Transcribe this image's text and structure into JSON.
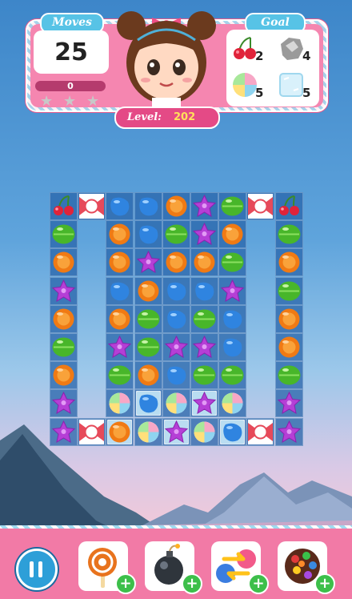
{
  "header": {
    "moves_label": "Moves",
    "moves_value": "25",
    "score_value": "0",
    "goal_label": "Goal",
    "level_label": "Level:",
    "level_value": "202",
    "stars_earned": 0,
    "stars_total": 3,
    "goals": [
      {
        "icon": "cherry-icon",
        "count": "2"
      },
      {
        "icon": "stone-icon",
        "count": "4"
      },
      {
        "icon": "swirl-candy-icon",
        "count": "5"
      },
      {
        "icon": "ice-block-icon",
        "count": "5"
      }
    ]
  },
  "board": {
    "cols": 9,
    "rows": 9,
    "rows_data": [
      [
        "cherry",
        "wrap",
        "blue",
        "blue",
        "orange",
        "purple",
        "green",
        "wrap",
        "cherry"
      ],
      [
        "green",
        "",
        "orange",
        "blue",
        "green",
        "purple",
        "orange",
        "",
        "green"
      ],
      [
        "orange",
        "",
        "orange",
        "purple",
        "orange",
        "orange",
        "green",
        "",
        "orange"
      ],
      [
        "purple",
        "",
        "blue",
        "orange",
        "blue",
        "blue",
        "purple",
        "",
        "green"
      ],
      [
        "orange",
        "",
        "orange",
        "green",
        "blue",
        "green",
        "blue",
        "",
        "orange"
      ],
      [
        "green",
        "",
        "purple",
        "green",
        "purple",
        "purple",
        "blue",
        "",
        "orange"
      ],
      [
        "orange",
        "",
        "green",
        "orange",
        "blue",
        "green",
        "green",
        "",
        "green"
      ],
      [
        "purple",
        "",
        "swirl",
        "blue-ice",
        "swirl",
        "purple-ice",
        "swirl",
        "",
        "purple"
      ],
      [
        "purple",
        "wrap",
        "orange-ice",
        "swirl",
        "purple-ice",
        "swirl",
        "blue-ice",
        "wrap",
        "purple"
      ]
    ]
  },
  "boosters": [
    {
      "name": "lollipop-icon"
    },
    {
      "name": "bomb-icon"
    },
    {
      "name": "swap-icon"
    },
    {
      "name": "color-ball-icon"
    }
  ],
  "colors": {
    "accent": "#f27aa6",
    "tag": "#57c3e6",
    "level_bg": "#e44a86",
    "level_value": "#ffe15a",
    "plus": "#3dbf4a"
  }
}
